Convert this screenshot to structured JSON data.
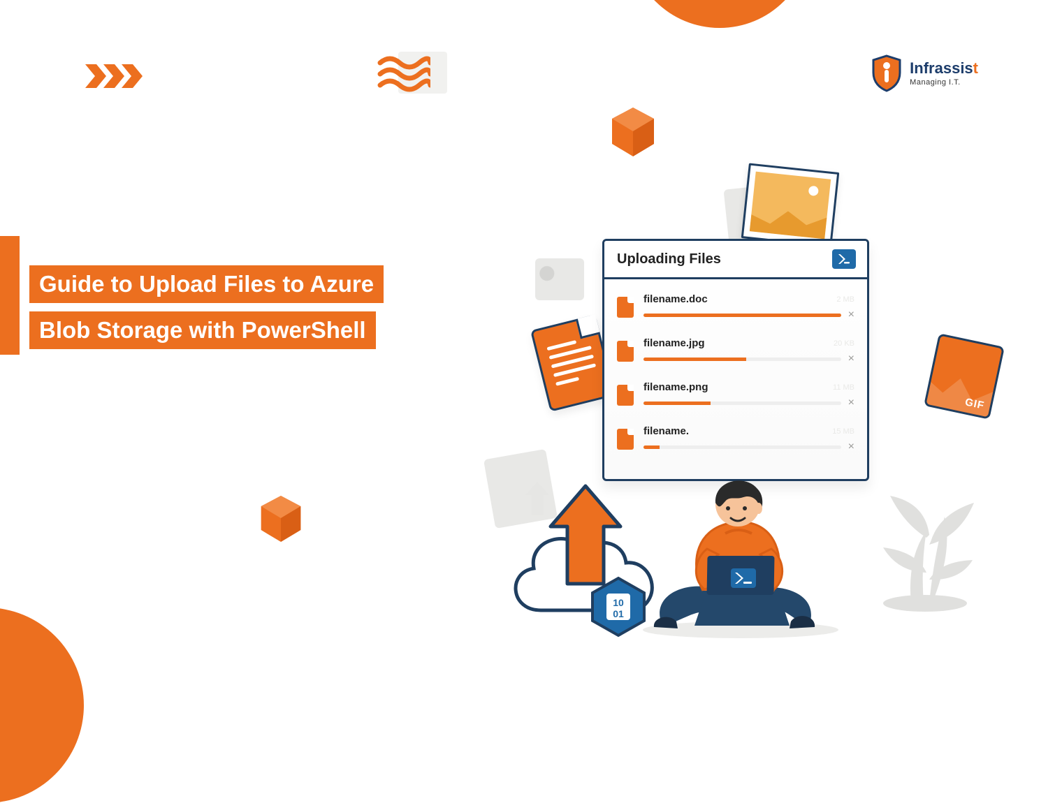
{
  "logo": {
    "brand_prefix": "Infrassis",
    "brand_suffix": "t",
    "tagline": "Managing I.T."
  },
  "title": {
    "line1": "Guide to Upload Files to Azure",
    "line2": "Blob Storage with PowerShell"
  },
  "upload_window": {
    "title": "Uploading Files",
    "files": [
      {
        "name": "filename.doc",
        "size": "2 MB",
        "progress": 100
      },
      {
        "name": "filename.jpg",
        "size": "20 KB",
        "progress": 52
      },
      {
        "name": "filename.png",
        "size": "11 MB",
        "progress": 34
      },
      {
        "name": "filename.",
        "size": "15 MB",
        "progress": 8
      }
    ]
  },
  "gif_label": "GIF",
  "azure_binary": {
    "row1": "10",
    "row2": "01"
  },
  "colors": {
    "orange": "#ec6f1f",
    "navy": "#1f3e60",
    "blue": "#1f6aa8"
  },
  "icons": {
    "chevrons": "chevrons-right-icon",
    "waves": "waves-icon",
    "shield": "shield-logo-icon",
    "cube": "cube-3d-icon",
    "powershell": "powershell-icon",
    "file": "file-icon",
    "close": "close-icon",
    "image": "image-icon",
    "gif": "gif-tile-icon",
    "doc": "document-icon",
    "arrow_up": "arrow-up-icon",
    "cloud": "cloud-upload-icon",
    "azure": "azure-storage-icon",
    "person": "person-laptop-icon",
    "plant": "plant-icon"
  }
}
